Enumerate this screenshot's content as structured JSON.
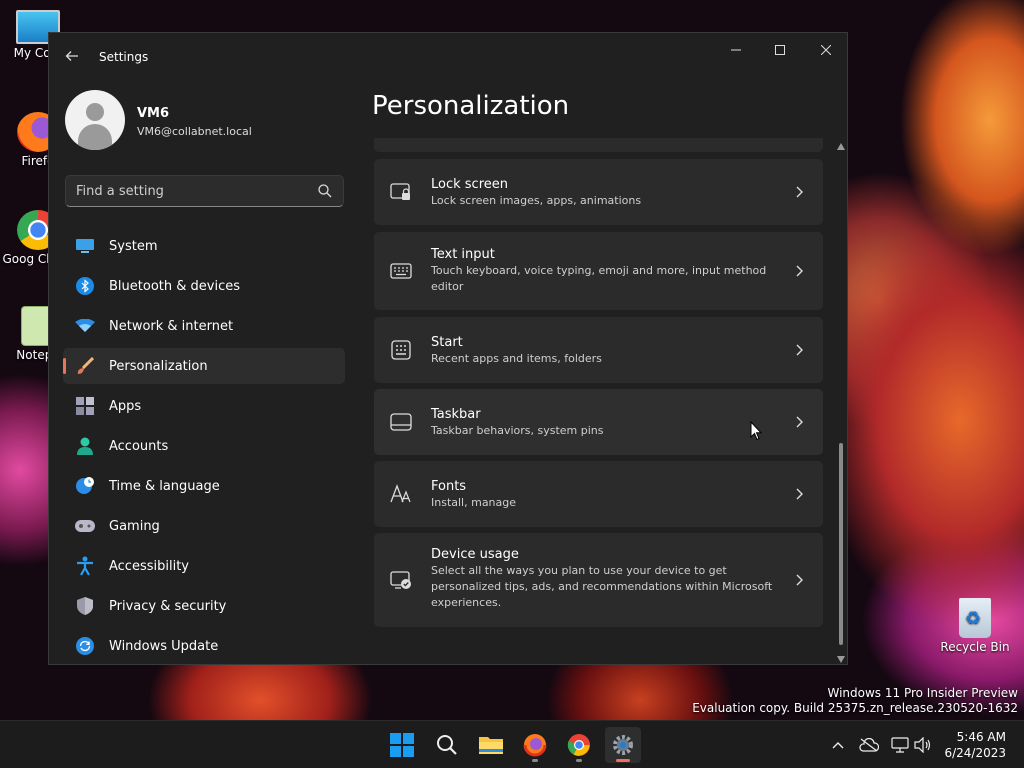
{
  "desktop": {
    "icons": [
      {
        "label": "My Com"
      },
      {
        "label": "Firefo"
      },
      {
        "label": "Goog Chron"
      },
      {
        "label": "Notepa"
      },
      {
        "label": "Recycle Bin"
      }
    ],
    "watermark": {
      "line1": "Windows 11 Pro Insider Preview",
      "line2": "Evaluation copy. Build 25375.zn_release.230520-1632"
    }
  },
  "window": {
    "title": "Settings"
  },
  "account": {
    "name": "VM6",
    "email": "VM6@collabnet.local"
  },
  "search": {
    "placeholder": "Find a setting"
  },
  "nav": {
    "items": [
      {
        "label": "System",
        "icon": "monitor-icon"
      },
      {
        "label": "Bluetooth & devices",
        "icon": "bluetooth-icon"
      },
      {
        "label": "Network & internet",
        "icon": "wifi-icon"
      },
      {
        "label": "Personalization",
        "icon": "brush-icon",
        "active": true
      },
      {
        "label": "Apps",
        "icon": "apps-icon"
      },
      {
        "label": "Accounts",
        "icon": "person-icon"
      },
      {
        "label": "Time & language",
        "icon": "globe-clock-icon"
      },
      {
        "label": "Gaming",
        "icon": "gamepad-icon"
      },
      {
        "label": "Accessibility",
        "icon": "accessibility-icon"
      },
      {
        "label": "Privacy & security",
        "icon": "shield-icon"
      },
      {
        "label": "Windows Update",
        "icon": "update-icon"
      }
    ]
  },
  "page": {
    "title": "Personalization",
    "cards": [
      {
        "title": "Lock screen",
        "desc": "Lock screen images, apps, animations",
        "icon": "lock-screen-icon"
      },
      {
        "title": "Text input",
        "desc": "Touch keyboard, voice typing, emoji and more, input method editor",
        "icon": "keyboard-icon"
      },
      {
        "title": "Start",
        "desc": "Recent apps and items, folders",
        "icon": "start-menu-icon"
      },
      {
        "title": "Taskbar",
        "desc": "Taskbar behaviors, system pins",
        "icon": "taskbar-icon"
      },
      {
        "title": "Fonts",
        "desc": "Install, manage",
        "icon": "fonts-icon"
      },
      {
        "title": "Device usage",
        "desc": "Select all the ways you plan to use your device to get personalized tips, ads, and recommendations within Microsoft experiences.",
        "icon": "device-usage-icon"
      }
    ]
  },
  "taskbar": {
    "time": "5:46 AM",
    "date": "6/24/2023"
  },
  "colors": {
    "accent": "#e8745a",
    "window_bg": "#202020",
    "card_bg": "#2b2b2b",
    "taskbar_bg": "#1c1c1c"
  }
}
